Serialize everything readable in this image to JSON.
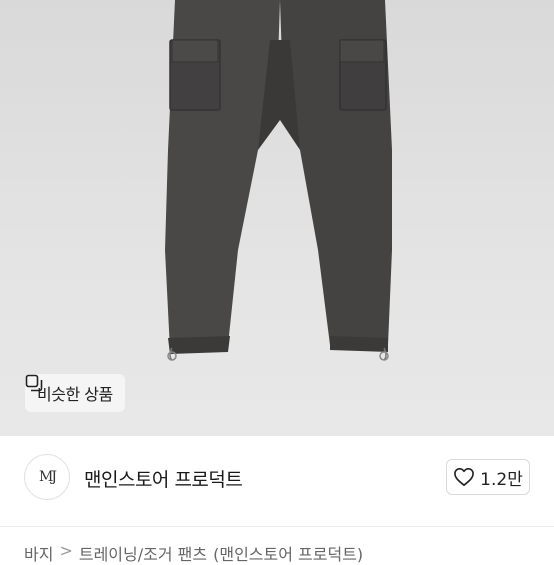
{
  "photo": {
    "subject": "charcoal cargo jogger pants product photo"
  },
  "similar_button": {
    "label": "비슷한 상품",
    "icon": "similar-items-icon"
  },
  "seller": {
    "avatar_text": "MJ",
    "name": "맨인스토어 프로덕트"
  },
  "like": {
    "icon": "heart-icon",
    "count": "1.2만"
  },
  "breadcrumb": {
    "items": [
      "바지",
      "트레이닝/조거 팬츠",
      "(맨인스토어 프로덕트)"
    ],
    "separator": ">"
  }
}
